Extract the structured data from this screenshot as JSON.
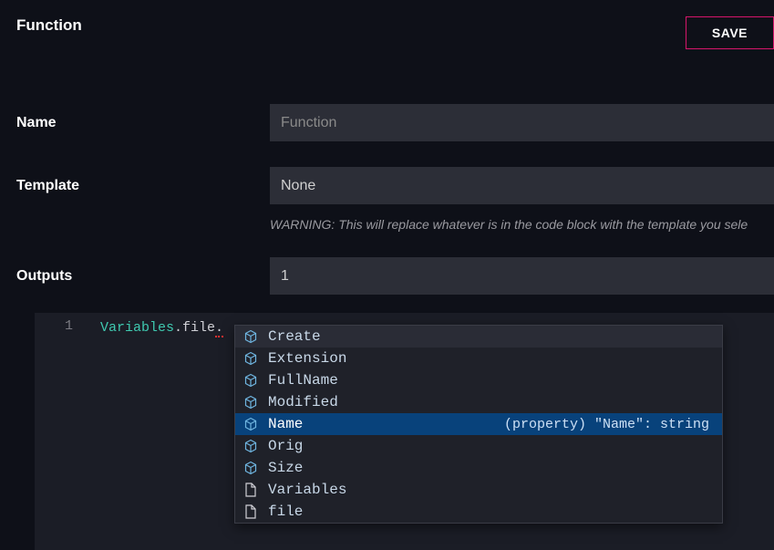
{
  "header": {
    "title": "Function",
    "save_label": "SAVE"
  },
  "form": {
    "name_label": "Name",
    "name_placeholder": "Function",
    "name_value": "",
    "template_label": "Template",
    "template_value": "None",
    "template_warning": "WARNING: This will replace whatever is in the code block with the template you sele",
    "outputs_label": "Outputs",
    "outputs_value": "1"
  },
  "editor": {
    "line_number": "1",
    "tok_variables": "Variables",
    "tok_dot1": ".",
    "tok_file": "file",
    "tok_dot2": "."
  },
  "autocomplete": {
    "items": [
      {
        "label": "Create",
        "icon": "cube",
        "state": "hover"
      },
      {
        "label": "Extension",
        "icon": "cube",
        "state": ""
      },
      {
        "label": "FullName",
        "icon": "cube",
        "state": ""
      },
      {
        "label": "Modified",
        "icon": "cube",
        "state": ""
      },
      {
        "label": "Name",
        "icon": "cube",
        "state": "selected",
        "detail": "(property) \"Name\": string"
      },
      {
        "label": "Orig",
        "icon": "cube",
        "state": ""
      },
      {
        "label": "Size",
        "icon": "cube",
        "state": ""
      },
      {
        "label": "Variables",
        "icon": "file",
        "state": ""
      },
      {
        "label": "file",
        "icon": "file",
        "state": ""
      }
    ]
  }
}
